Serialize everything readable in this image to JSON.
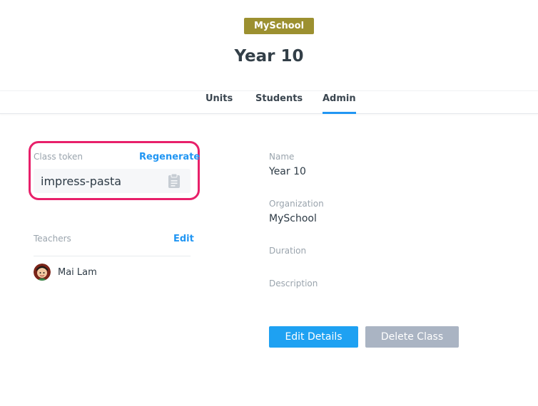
{
  "header": {
    "org_badge": "MySchool",
    "class_title": "Year 10",
    "colors": {
      "badge": "#9c9030",
      "accent": "#2196f3"
    }
  },
  "tabs": [
    {
      "label": "Units",
      "active": false
    },
    {
      "label": "Students",
      "active": false
    },
    {
      "label": "Admin",
      "active": true
    }
  ],
  "token": {
    "label": "Class token",
    "regenerate_label": "Regenerate",
    "value": "impress-pasta",
    "copy_icon": "clipboard-icon",
    "highlight_color": "#e8206a"
  },
  "teachers": {
    "label": "Teachers",
    "edit_label": "Edit",
    "items": [
      {
        "name": "Mai Lam",
        "avatar_icon": "avatar-icon"
      }
    ]
  },
  "details": {
    "name_label": "Name",
    "name_value": "Year 10",
    "organization_label": "Organization",
    "organization_value": "MySchool",
    "duration_label": "Duration",
    "duration_value": "",
    "description_label": "Description",
    "description_value": ""
  },
  "actions": {
    "edit_details": "Edit Details",
    "delete_class": "Delete Class"
  }
}
